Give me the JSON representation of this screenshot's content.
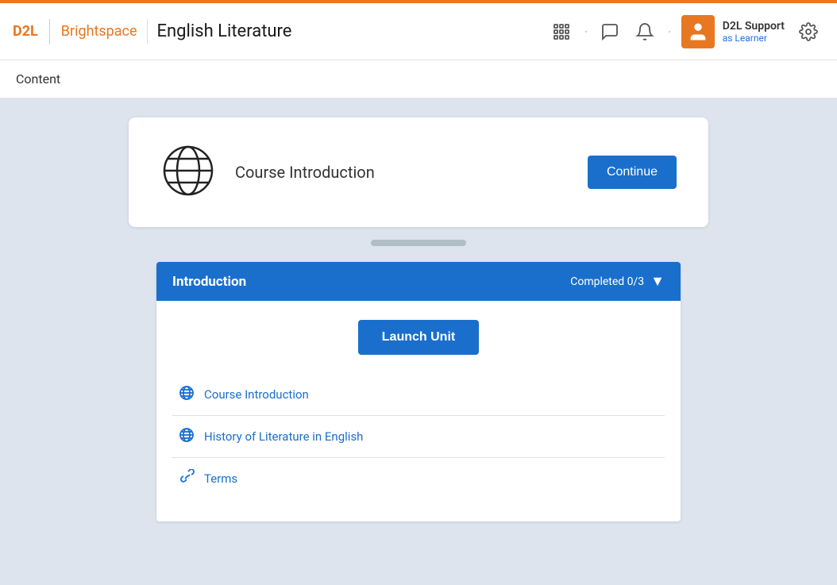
{
  "brand": {
    "d2l": "D2L",
    "brightspace": "Brightspace"
  },
  "header": {
    "course_title": "English Literature"
  },
  "nav": {
    "apps_icon": "apps-icon",
    "chat_icon": "chat-icon",
    "bell_icon": "bell-icon"
  },
  "user": {
    "name": "D2L Support",
    "role": "as Learner"
  },
  "breadcrumb": "Content",
  "course_intro": {
    "title": "Course Introduction",
    "continue_button": "Continue"
  },
  "introduction_section": {
    "title": "Introduction",
    "progress": "Completed 0/3",
    "launch_button": "Launch Unit",
    "items": [
      {
        "icon": "globe",
        "label": "Course Introduction"
      },
      {
        "icon": "globe",
        "label": "History of Literature in English"
      },
      {
        "icon": "link",
        "label": "Terms"
      }
    ]
  }
}
